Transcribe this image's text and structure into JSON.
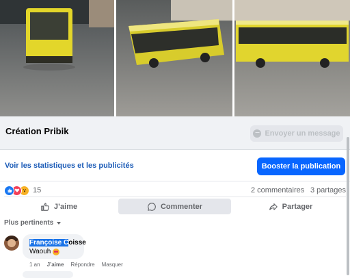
{
  "post": {
    "page_name": "Création Pribik",
    "message_button": "Envoyer un message",
    "stats_link": "Voir les statistiques et les publicités",
    "boost_button": "Booster la publication",
    "reaction_count": "15",
    "comments_count": "2 commentaires",
    "shares_count": "3 partages"
  },
  "actions": {
    "like": "J’aime",
    "comment": "Commenter",
    "share": "Partager"
  },
  "sort": {
    "label": "Plus pertinents"
  },
  "comment": {
    "author_selected": "Françoise C",
    "author_rest": "oisse",
    "text": "Waouh",
    "time": "1 an",
    "like": "J’aime",
    "reply": "Répondre",
    "hide": "Masquer"
  },
  "colors": {
    "primary": "#0866ff",
    "link": "#1b5bb7",
    "muted": "#65676b",
    "surface": "#f0f2f5"
  },
  "icons": [
    "messenger-icon",
    "like-reaction-icon",
    "love-reaction-icon",
    "wow-reaction-icon",
    "thumbs-up-icon",
    "comment-icon",
    "share-icon",
    "caret-down-icon"
  ]
}
